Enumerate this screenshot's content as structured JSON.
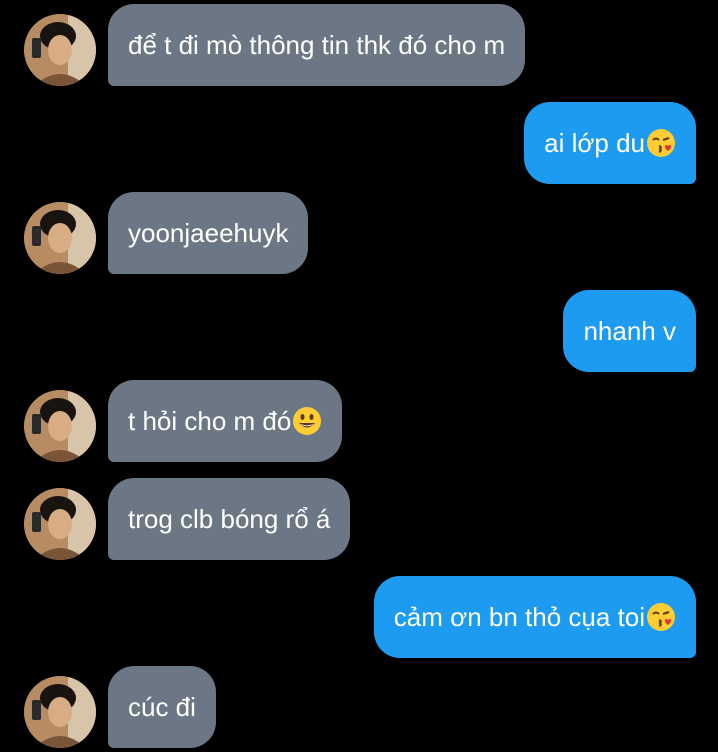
{
  "messages": [
    {
      "side": "in",
      "text": "để t đi mò thông tin thk đó cho m",
      "emoji": null
    },
    {
      "side": "out",
      "text": "ai lớp du",
      "emoji": "kissing-face-icon"
    },
    {
      "side": "in",
      "text": "yoonjaeehuyk",
      "emoji": null
    },
    {
      "side": "out",
      "text": "nhanh v",
      "emoji": null
    },
    {
      "side": "in",
      "text": "t hỏi cho m đó",
      "emoji": "smiling-face-icon"
    },
    {
      "side": "in",
      "text": "trog clb bóng rổ á",
      "emoji": null
    },
    {
      "side": "out",
      "text": "cảm ơn bn thỏ cụa toi",
      "emoji": "kissing-face-icon"
    },
    {
      "side": "in",
      "text": "cúc đi",
      "emoji": null
    }
  ],
  "colors": {
    "background": "#000000",
    "incoming_bubble": "#6b7784",
    "outgoing_bubble": "#1d9bf0",
    "text": "#ffffff"
  }
}
